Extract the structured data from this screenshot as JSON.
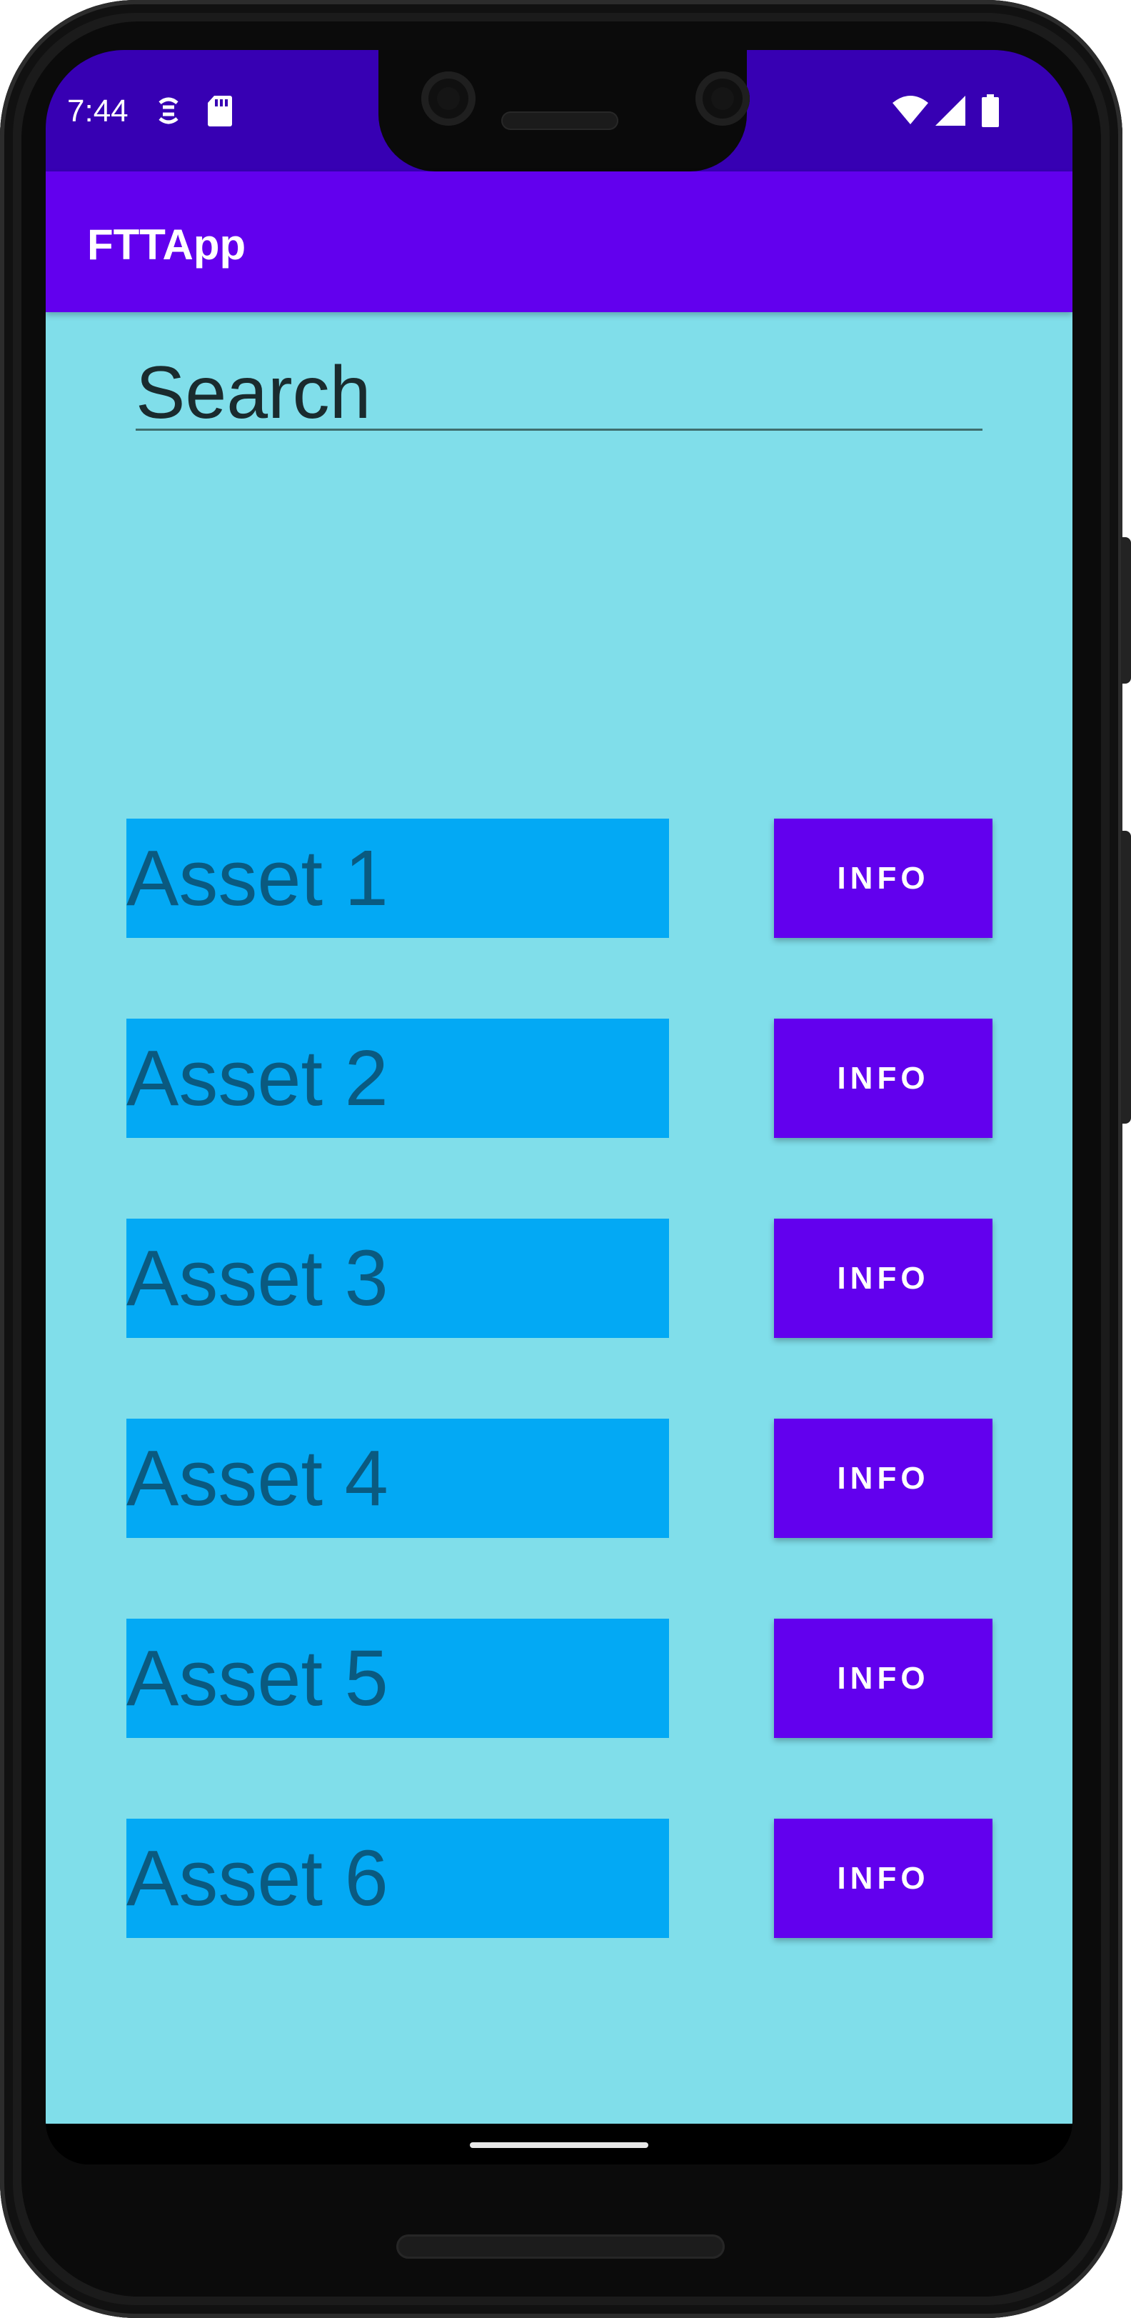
{
  "status_bar": {
    "time": "7:44",
    "icons": [
      "sync-icon",
      "sd-card-icon",
      "wifi-icon",
      "signal-icon",
      "battery-icon"
    ]
  },
  "app_bar": {
    "title": "FTTApp"
  },
  "search": {
    "placeholder": "Search"
  },
  "assets": [
    {
      "label": "Asset 1",
      "button_label": "INFO"
    },
    {
      "label": "Asset 2",
      "button_label": "INFO"
    },
    {
      "label": "Asset 3",
      "button_label": "INFO"
    },
    {
      "label": "Asset 4",
      "button_label": "INFO"
    },
    {
      "label": "Asset 5",
      "button_label": "INFO"
    },
    {
      "label": "Asset 6",
      "button_label": "INFO"
    }
  ],
  "colors": {
    "status_bar": "#3700b3",
    "app_bar": "#6200ee",
    "background": "#80deea",
    "asset_label_bg": "#03a9f4",
    "asset_label_text": "#0a5a80",
    "button": "#6200ee"
  }
}
